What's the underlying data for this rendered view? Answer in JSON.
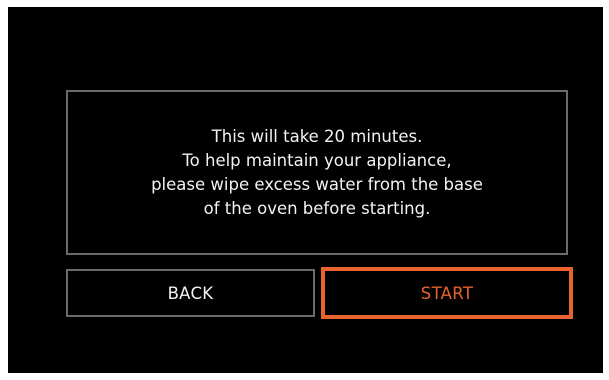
{
  "dialog": {
    "message_lines": [
      "This will take 20 minutes.",
      "To help maintain your appliance,",
      "please wipe excess water from the base",
      "of the oven before starting."
    ]
  },
  "buttons": {
    "back_label": "BACK",
    "start_label": "START"
  },
  "colors": {
    "background": "#000000",
    "border": "#6b6b6b",
    "accent": "#e8622c",
    "text": "#f2f2f2"
  }
}
